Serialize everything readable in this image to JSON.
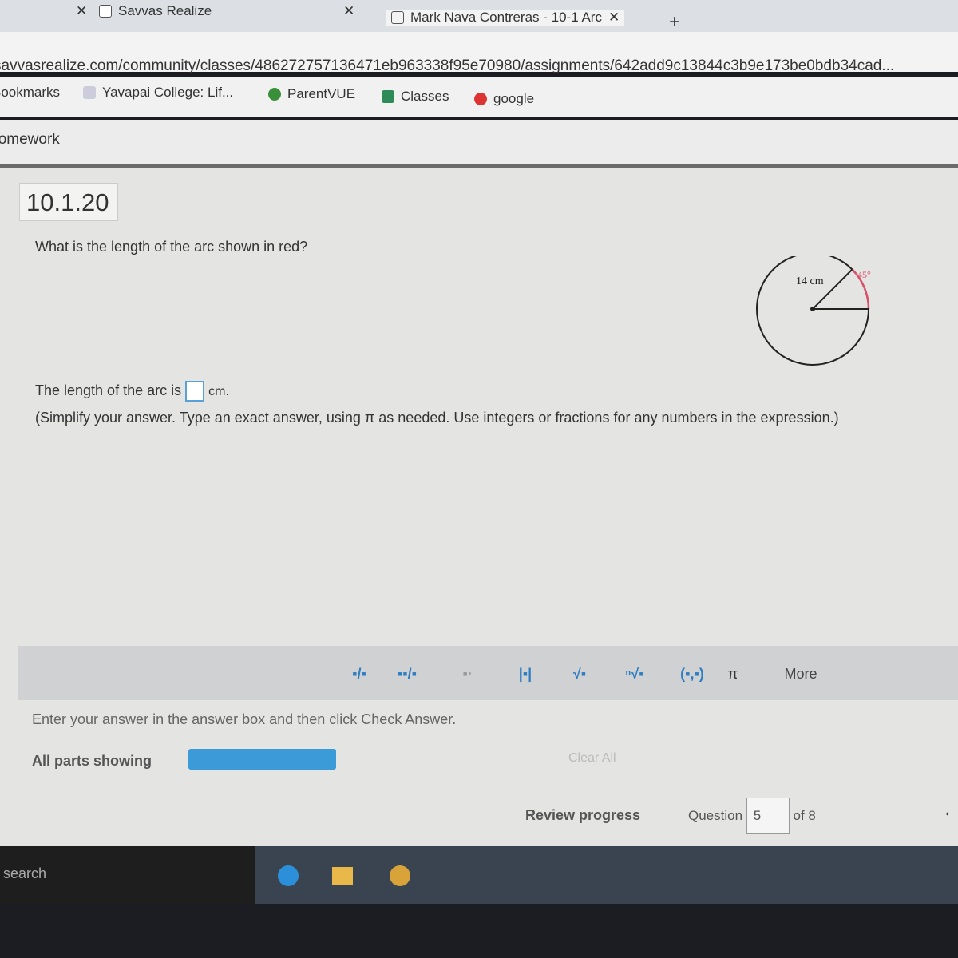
{
  "browser": {
    "tabs": [
      {
        "label": "Savvas Realize"
      },
      {
        "label": "Mark Nava Contreras - 10-1 Arc"
      }
    ],
    "new_tab": "+",
    "url": "savvasrealize.com/community/classes/486272757136471eb963338f95e70980/assignments/642add9c13844c3b9e173be0bdb34cad...",
    "bookmarks_label": "Bookmarks",
    "bookmarks": [
      {
        "label": "Yavapai College: Lif..."
      },
      {
        "label": "ParentVUE"
      },
      {
        "label": "Classes"
      },
      {
        "label": "google"
      }
    ]
  },
  "page_header": "Homework",
  "question": {
    "id": "10.1.20",
    "prompt": "What is the length of the arc shown in red?",
    "figure": {
      "radius_label": "14 cm",
      "angle_label": "45°",
      "arc_color": "#d9506a"
    },
    "answer_prefix": "The length of the arc is",
    "answer_value": "",
    "answer_unit": "cm.",
    "instruction": "(Simplify your answer. Type an exact answer, using π as needed. Use integers or fractions for any numbers in the expression.)"
  },
  "palette": {
    "buttons": [
      {
        "label": "fraction",
        "glyph": "▪/▪"
      },
      {
        "label": "mixed number",
        "glyph": "▪▪/▪"
      },
      {
        "label": "exponent",
        "glyph": "▪ᐧ"
      },
      {
        "label": "absolute value",
        "glyph": "|▪|"
      },
      {
        "label": "square root",
        "glyph": "√▪"
      },
      {
        "label": "nth root",
        "glyph": "ⁿ√▪"
      },
      {
        "label": "ordered pair",
        "glyph": "(▪,▪)"
      },
      {
        "label": "pi",
        "glyph": "π"
      },
      {
        "label": "more",
        "glyph": "More"
      }
    ]
  },
  "footer": {
    "hint": "Enter your answer in the answer box and then click Check Answer.",
    "parts_label": "All parts showing",
    "progress": 1.0,
    "clear_all": "Clear All",
    "review_progress": "Review progress",
    "question_label": "Question",
    "question_number": "5",
    "of_label": "of 8"
  },
  "taskbar": {
    "search": "search"
  }
}
